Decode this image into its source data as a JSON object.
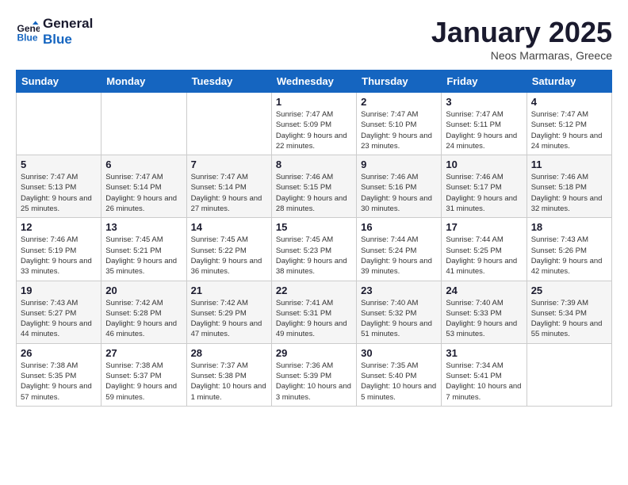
{
  "header": {
    "logo_line1": "General",
    "logo_line2": "Blue",
    "title": "January 2025",
    "subtitle": "Neos Marmaras, Greece"
  },
  "days_of_week": [
    "Sunday",
    "Monday",
    "Tuesday",
    "Wednesday",
    "Thursday",
    "Friday",
    "Saturday"
  ],
  "weeks": [
    [
      {
        "day": "",
        "info": ""
      },
      {
        "day": "",
        "info": ""
      },
      {
        "day": "",
        "info": ""
      },
      {
        "day": "1",
        "info": "Sunrise: 7:47 AM\nSunset: 5:09 PM\nDaylight: 9 hours and 22 minutes."
      },
      {
        "day": "2",
        "info": "Sunrise: 7:47 AM\nSunset: 5:10 PM\nDaylight: 9 hours and 23 minutes."
      },
      {
        "day": "3",
        "info": "Sunrise: 7:47 AM\nSunset: 5:11 PM\nDaylight: 9 hours and 24 minutes."
      },
      {
        "day": "4",
        "info": "Sunrise: 7:47 AM\nSunset: 5:12 PM\nDaylight: 9 hours and 24 minutes."
      }
    ],
    [
      {
        "day": "5",
        "info": "Sunrise: 7:47 AM\nSunset: 5:13 PM\nDaylight: 9 hours and 25 minutes."
      },
      {
        "day": "6",
        "info": "Sunrise: 7:47 AM\nSunset: 5:14 PM\nDaylight: 9 hours and 26 minutes."
      },
      {
        "day": "7",
        "info": "Sunrise: 7:47 AM\nSunset: 5:14 PM\nDaylight: 9 hours and 27 minutes."
      },
      {
        "day": "8",
        "info": "Sunrise: 7:46 AM\nSunset: 5:15 PM\nDaylight: 9 hours and 28 minutes."
      },
      {
        "day": "9",
        "info": "Sunrise: 7:46 AM\nSunset: 5:16 PM\nDaylight: 9 hours and 30 minutes."
      },
      {
        "day": "10",
        "info": "Sunrise: 7:46 AM\nSunset: 5:17 PM\nDaylight: 9 hours and 31 minutes."
      },
      {
        "day": "11",
        "info": "Sunrise: 7:46 AM\nSunset: 5:18 PM\nDaylight: 9 hours and 32 minutes."
      }
    ],
    [
      {
        "day": "12",
        "info": "Sunrise: 7:46 AM\nSunset: 5:19 PM\nDaylight: 9 hours and 33 minutes."
      },
      {
        "day": "13",
        "info": "Sunrise: 7:45 AM\nSunset: 5:21 PM\nDaylight: 9 hours and 35 minutes."
      },
      {
        "day": "14",
        "info": "Sunrise: 7:45 AM\nSunset: 5:22 PM\nDaylight: 9 hours and 36 minutes."
      },
      {
        "day": "15",
        "info": "Sunrise: 7:45 AM\nSunset: 5:23 PM\nDaylight: 9 hours and 38 minutes."
      },
      {
        "day": "16",
        "info": "Sunrise: 7:44 AM\nSunset: 5:24 PM\nDaylight: 9 hours and 39 minutes."
      },
      {
        "day": "17",
        "info": "Sunrise: 7:44 AM\nSunset: 5:25 PM\nDaylight: 9 hours and 41 minutes."
      },
      {
        "day": "18",
        "info": "Sunrise: 7:43 AM\nSunset: 5:26 PM\nDaylight: 9 hours and 42 minutes."
      }
    ],
    [
      {
        "day": "19",
        "info": "Sunrise: 7:43 AM\nSunset: 5:27 PM\nDaylight: 9 hours and 44 minutes."
      },
      {
        "day": "20",
        "info": "Sunrise: 7:42 AM\nSunset: 5:28 PM\nDaylight: 9 hours and 46 minutes."
      },
      {
        "day": "21",
        "info": "Sunrise: 7:42 AM\nSunset: 5:29 PM\nDaylight: 9 hours and 47 minutes."
      },
      {
        "day": "22",
        "info": "Sunrise: 7:41 AM\nSunset: 5:31 PM\nDaylight: 9 hours and 49 minutes."
      },
      {
        "day": "23",
        "info": "Sunrise: 7:40 AM\nSunset: 5:32 PM\nDaylight: 9 hours and 51 minutes."
      },
      {
        "day": "24",
        "info": "Sunrise: 7:40 AM\nSunset: 5:33 PM\nDaylight: 9 hours and 53 minutes."
      },
      {
        "day": "25",
        "info": "Sunrise: 7:39 AM\nSunset: 5:34 PM\nDaylight: 9 hours and 55 minutes."
      }
    ],
    [
      {
        "day": "26",
        "info": "Sunrise: 7:38 AM\nSunset: 5:35 PM\nDaylight: 9 hours and 57 minutes."
      },
      {
        "day": "27",
        "info": "Sunrise: 7:38 AM\nSunset: 5:37 PM\nDaylight: 9 hours and 59 minutes."
      },
      {
        "day": "28",
        "info": "Sunrise: 7:37 AM\nSunset: 5:38 PM\nDaylight: 10 hours and 1 minute."
      },
      {
        "day": "29",
        "info": "Sunrise: 7:36 AM\nSunset: 5:39 PM\nDaylight: 10 hours and 3 minutes."
      },
      {
        "day": "30",
        "info": "Sunrise: 7:35 AM\nSunset: 5:40 PM\nDaylight: 10 hours and 5 minutes."
      },
      {
        "day": "31",
        "info": "Sunrise: 7:34 AM\nSunset: 5:41 PM\nDaylight: 10 hours and 7 minutes."
      },
      {
        "day": "",
        "info": ""
      }
    ]
  ]
}
